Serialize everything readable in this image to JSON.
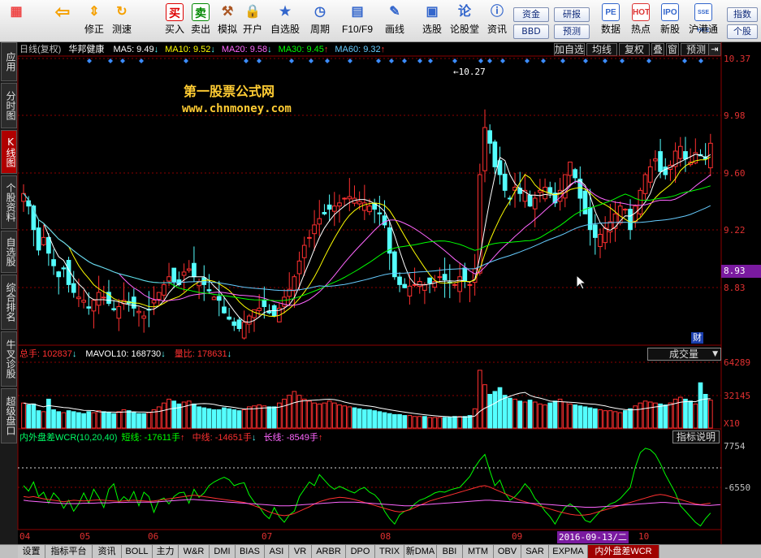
{
  "toolbar": {
    "items": [
      {
        "label": "",
        "icon": "grid-icon",
        "color": "#e44"
      },
      {
        "label": "",
        "icon": "back-arrow-icon",
        "color": "#f5a000"
      },
      {
        "label": "修正",
        "icon": "up-down-arrows-icon",
        "color": "#f5a000"
      },
      {
        "label": "测速",
        "icon": "refresh-icon",
        "color": "#f5a000"
      },
      {
        "label": "买入",
        "icon": "buy-icon",
        "text": "买",
        "color": "#d00"
      },
      {
        "label": "卖出",
        "icon": "sell-icon",
        "text": "卖",
        "color": "#080"
      },
      {
        "label": "模拟",
        "icon": "hammer-icon",
        "color": "#a52"
      },
      {
        "label": "开户",
        "icon": "lock-icon",
        "color": "#b80"
      },
      {
        "label": "自选股",
        "icon": "star-icon",
        "color": "#36c"
      },
      {
        "label": "周期",
        "icon": "clock-icon",
        "color": "#36c"
      },
      {
        "label": "F10/F9",
        "icon": "doc-icon",
        "color": "#36c"
      },
      {
        "label": "画线",
        "icon": "pen-icon",
        "color": "#36c"
      },
      {
        "label": "选股",
        "icon": "screen-icon",
        "color": "#36c"
      },
      {
        "label": "论股堂",
        "icon": "forum-icon",
        "color": "#36c"
      },
      {
        "label": "资讯",
        "icon": "info-icon",
        "color": "#36c"
      },
      {
        "label": "数据",
        "icon": "pe-icon",
        "text": "PE",
        "color": "#36c"
      },
      {
        "label": "热点",
        "icon": "hot-icon",
        "text": "HOT",
        "color": "#d33"
      },
      {
        "label": "新股",
        "icon": "ipo-icon",
        "text": "IPO",
        "color": "#36c"
      },
      {
        "label": "沪港通",
        "icon": "sse-hke-icon",
        "text": "SSE HKE",
        "color": "#36c"
      }
    ],
    "pills": {
      "capital": "资金",
      "bbd": "BBD",
      "research": "研报",
      "forecast": "预测",
      "index": "指数",
      "stock": "个股"
    }
  },
  "left_tabs": [
    "应用",
    "分时图",
    "K线图",
    "个股资料",
    "自选股",
    "综合排名",
    "牛叉诊股",
    "超级盘口"
  ],
  "active_left_tab": "K线图",
  "kline_header": {
    "period": "日线(复权)",
    "stock": "华邦健康",
    "ma": [
      {
        "label": "MA5:",
        "value": "9.49",
        "arrow": "↓",
        "color": "#ffffff"
      },
      {
        "label": "MA10:",
        "value": "9.52",
        "arrow": "↓",
        "color": "#ffff00"
      },
      {
        "label": "MA20:",
        "value": "9.58",
        "arrow": "↓",
        "color": "#ff66ff"
      },
      {
        "label": "MA30:",
        "value": "9.45",
        "arrow": "↑",
        "color": "#00ff00"
      },
      {
        "label": "MA60:",
        "value": "9.32",
        "arrow": "↑",
        "color": "#66ccff"
      }
    ],
    "buttons": [
      "加自选",
      "均线",
      "复权",
      "叠",
      "窗",
      "预测"
    ]
  },
  "watermark": {
    "title": "第一股票公式网",
    "url": "www.chnmoney.com"
  },
  "price_axis": {
    "labels": [
      "10.37",
      "9.98",
      "9.60",
      "9.22",
      "8.83"
    ],
    "current": "8.93",
    "high_marker": "10.27",
    "fin_badge": "财"
  },
  "volume_header": {
    "total_label": "总手:",
    "total": "102837",
    "mavol_label": "MAVOL10:",
    "mavol": "168730",
    "ratio_label": "量比:",
    "ratio": "178631",
    "dropdown": "成交量"
  },
  "volume_axis": {
    "labels": [
      "64289",
      "32145"
    ],
    "unit": "X10"
  },
  "indicator_header": {
    "name": "内外盘差WCR(10,20,40)",
    "short_label": "短线:",
    "short": "-17611手",
    "mid_label": "中线:",
    "mid": "-14651手",
    "long_label": "长线:",
    "long": "-8549手",
    "help": "指标说明"
  },
  "indicator_axis": {
    "labels": [
      "7754",
      "-6550"
    ]
  },
  "x_axis": {
    "months": [
      "04",
      "05",
      "06",
      "07",
      "08",
      "09",
      "10"
    ],
    "cursor_date": "2016-09-13/二"
  },
  "bottom_tabs": [
    "设置",
    "指标平台",
    "资讯",
    "BOLL",
    "主力",
    "W&R",
    "DMI",
    "BIAS",
    "ASI",
    "VR",
    "ARBR",
    "DPO",
    "TRIX",
    "新DMA",
    "BBI",
    "MTM",
    "OBV",
    "SAR",
    "EXPMA",
    "内外盘差WCR"
  ],
  "active_bottom_tab": "内外盘差WCR",
  "chart_data": {
    "type": "candlestick",
    "y_range": [
      8.64,
      10.45
    ],
    "ma_periods": [
      5,
      10,
      20,
      30,
      60
    ],
    "closes": [
      9.58,
      9.5,
      9.35,
      9.22,
      9.3,
      9.2,
      9.12,
      9.05,
      9.1,
      9.0,
      8.95,
      8.92,
      8.9,
      8.85,
      8.9,
      8.95,
      8.92,
      8.88,
      8.84,
      8.86,
      8.9,
      8.88,
      8.85,
      8.83,
      8.8,
      8.84,
      8.9,
      8.95,
      9.0,
      9.05,
      9.02,
      9.0,
      9.08,
      9.1,
      9.05,
      9.02,
      9.0,
      8.96,
      8.92,
      8.9,
      8.82,
      8.78,
      8.74,
      8.72,
      8.76,
      8.8,
      8.84,
      8.85,
      8.86,
      8.82,
      8.8,
      8.85,
      8.92,
      8.97,
      9.05,
      9.15,
      9.25,
      9.3,
      9.38,
      9.42,
      9.45,
      9.48,
      9.5,
      9.52,
      9.55,
      9.56,
      9.55,
      9.53,
      9.52,
      9.5,
      9.48,
      9.45,
      9.38,
      9.2,
      9.05,
      9.0,
      8.98,
      8.99,
      9.0,
      9.02,
      9.0,
      9.01,
      9.02,
      9.05,
      9.03,
      9.01,
      9.0,
      9.05,
      9.02,
      9.0,
      9.1,
      9.7,
      10.0,
      9.9,
      9.75,
      9.7,
      9.6,
      9.55,
      9.62,
      9.58,
      9.6,
      9.5,
      9.55,
      9.6,
      9.62,
      9.58,
      9.52,
      9.6,
      9.7,
      9.78,
      9.68,
      9.55,
      9.45,
      9.35,
      9.3,
      9.32,
      9.36,
      9.4,
      9.45,
      9.5,
      9.48,
      9.35,
      9.5,
      9.6,
      9.7,
      9.75,
      9.8,
      9.72,
      9.7,
      9.76,
      9.85,
      9.88,
      9.8,
      9.78,
      9.84,
      9.82,
      9.8,
      9.9
    ],
    "volume_range": [
      0,
      70000
    ],
    "volumes": [
      26000,
      24000,
      25000,
      18000,
      17000,
      30000,
      19000,
      17000,
      16000,
      18000,
      17000,
      16000,
      15000,
      17000,
      16000,
      18000,
      17000,
      16000,
      15000,
      17000,
      19000,
      18000,
      16000,
      15000,
      15000,
      16000,
      19000,
      22000,
      26000,
      30000,
      28000,
      25000,
      27000,
      28000,
      25000,
      22000,
      21000,
      20000,
      19000,
      19000,
      21000,
      20000,
      19000,
      18000,
      19000,
      22000,
      23000,
      24000,
      23000,
      22000,
      22000,
      26000,
      30000,
      34000,
      38000,
      34000,
      30000,
      28000,
      26000,
      25000,
      26000,
      28000,
      26000,
      24000,
      23000,
      22000,
      21000,
      20000,
      19000,
      19000,
      18000,
      17000,
      16000,
      15000,
      14000,
      14000,
      13000,
      13000,
      12000,
      12000,
      12000,
      11000,
      11000,
      11000,
      11000,
      11000,
      12000,
      12000,
      12000,
      13000,
      20000,
      60000,
      45000,
      35000,
      38000,
      42000,
      34000,
      31000,
      30000,
      28000,
      27000,
      29000,
      27000,
      25000,
      24000,
      26000,
      28000,
      30000,
      27000,
      25000,
      24000,
      23000,
      22000,
      21000,
      20000,
      19000,
      18000,
      18000,
      17000,
      16000,
      18000,
      20000,
      23000,
      26000,
      28000,
      27000,
      26000,
      25000,
      24000,
      26000,
      30000,
      32000,
      30000,
      28000,
      25000,
      47000,
      35000,
      29000
    ],
    "indicator_range": [
      -14000,
      9500
    ],
    "wcr_short": [
      -2000,
      -3500,
      -1000,
      -5000,
      -3800,
      -6800,
      -4000,
      -5500,
      -8200,
      -6000,
      -9000,
      -7000,
      -4000,
      -6800,
      -3000,
      -5200,
      -8000,
      -3000,
      -1500,
      -6600,
      -5000,
      -6200,
      -3600,
      -7500,
      -3800,
      -5000,
      -9300,
      -6000,
      -5400,
      -7000,
      -5000,
      -4000,
      -3800,
      -6800,
      -3000,
      -5200,
      -4000,
      -2000,
      -1000,
      -300,
      300,
      -400,
      -2000,
      -1500,
      -1200,
      -4500,
      -6500,
      -7800,
      -9800,
      -11000,
      -8000,
      -10500,
      -12000,
      -10000,
      -9000,
      -5000,
      -3000,
      -1000,
      -2000,
      1000,
      -500,
      -2000,
      -3000,
      -2200,
      -2800,
      -3500,
      -4000,
      -3000,
      -2500,
      -3800,
      -4500,
      -6000,
      -9000,
      -11000,
      -12500,
      -10000,
      -9000,
      -8500,
      -7000,
      -6000,
      -5500,
      -4800,
      -4000,
      -3600,
      -3800,
      -3200,
      -2800,
      -2500,
      -1000,
      500,
      3000,
      5000,
      6500,
      2000,
      -2000,
      -500,
      -4000,
      -6000,
      -5000,
      -3500,
      -1500,
      -3000,
      -5500,
      -7000,
      -9000,
      -10500,
      -12500,
      -10000,
      -8000,
      -7000,
      -8000,
      -9500,
      -11500,
      -12000,
      -10500,
      -9000,
      -8000,
      -7000,
      -6500,
      -5500,
      -4000,
      -2500,
      3000,
      7000,
      8200,
      7800,
      6500,
      4000,
      1000,
      -1500,
      -4000,
      -7500,
      -9000,
      -10500,
      -12000,
      -13000,
      -11000,
      -9500
    ],
    "wcr_mid": [
      -5000,
      -5200,
      -5000,
      -5300,
      -5600,
      -5800,
      -6000,
      -6200,
      -6400,
      -6200,
      -6000,
      -6100,
      -6200,
      -6100,
      -6000,
      -5900,
      -6000,
      -6100,
      -6200,
      -6300,
      -6200,
      -6100,
      -6000,
      -6100,
      -6200,
      -6300,
      -6200,
      -6000,
      -5800,
      -5600,
      -5400,
      -5200,
      -5000,
      -4800,
      -4600,
      -4800,
      -5000,
      -5200,
      -5400,
      -5600,
      -5800,
      -6000,
      -6200,
      -6400,
      -6600,
      -7000,
      -7500,
      -8000,
      -8600,
      -9200,
      -9600,
      -10000,
      -10200,
      -10000,
      -9600,
      -9000,
      -8400,
      -7800,
      -7000,
      -6400,
      -6000,
      -5600,
      -5400,
      -5200,
      -5300,
      -5500,
      -5800,
      -6200,
      -6600,
      -7000,
      -7400,
      -7800,
      -8200,
      -8600,
      -9000,
      -9200,
      -9000,
      -8600,
      -8000,
      -7400,
      -6800,
      -6200,
      -5800,
      -5400,
      -5000,
      -4600,
      -4200,
      -3800,
      -3400,
      -3000,
      -2600,
      -2200,
      -2000,
      -2400,
      -3000,
      -3600,
      -4200,
      -4800,
      -5400,
      -6000,
      -6400,
      -6800,
      -7200,
      -7600,
      -8000,
      -8400,
      -8800,
      -9200,
      -9500,
      -9800,
      -10000,
      -10100,
      -10000,
      -9800,
      -9400,
      -9000,
      -8600,
      -8200,
      -7800,
      -7400,
      -7000,
      -6600,
      -6200,
      -5800,
      -5400,
      -5000,
      -4600,
      -4400,
      -4600,
      -5000,
      -5400,
      -5800,
      -6200,
      -6600,
      -7000,
      -7200,
      -7000,
      -6800
    ],
    "wcr_long": [
      -6000,
      -6200,
      -6300,
      -6400,
      -6500,
      -6600,
      -6700,
      -6800,
      -6900,
      -6900,
      -6900,
      -6900,
      -6800,
      -6800,
      -6800,
      -6700,
      -6700,
      -6700,
      -6600,
      -6600,
      -6600,
      -6500,
      -6500,
      -6500,
      -6500,
      -6500,
      -6500,
      -6400,
      -6300,
      -6200,
      -6100,
      -6000,
      -5900,
      -5800,
      -5800,
      -5900,
      -6000,
      -6100,
      -6200,
      -6300,
      -6400,
      -6500,
      -6600,
      -6700,
      -6800,
      -6900,
      -7000,
      -7100,
      -7200,
      -7300,
      -7400,
      -7500,
      -7500,
      -7500,
      -7400,
      -7300,
      -7200,
      -7100,
      -7000,
      -6900,
      -6800,
      -6700,
      -6600,
      -6500,
      -6500,
      -6500,
      -6500,
      -6600,
      -6700,
      -6800,
      -6900,
      -7000,
      -7100,
      -7200,
      -7300,
      -7400,
      -7500,
      -7500,
      -7400,
      -7300,
      -7200,
      -7100,
      -7000,
      -6900,
      -6800,
      -6700,
      -6600,
      -6500,
      -6400,
      -6300,
      -6200,
      -6100,
      -6000,
      -6000,
      -6100,
      -6200,
      -6300,
      -6400,
      -6500,
      -6600,
      -6700,
      -6800,
      -6900,
      -7000,
      -7100,
      -7200,
      -7300,
      -7400,
      -7500,
      -7600,
      -7700,
      -7800,
      -7900,
      -7900,
      -7900,
      -7800,
      -7700,
      -7600,
      -7500,
      -7400,
      -7300,
      -7200,
      -7100,
      -7000,
      -6900,
      -6800,
      -6700,
      -6600,
      -6600,
      -6700,
      -6800,
      -6900,
      -7000,
      -7100,
      -7200,
      -7300,
      -7400,
      -7400,
      -7300,
      -7200
    ]
  },
  "colors": {
    "up": "#ff3030",
    "down": "#54ffff",
    "ma5": "#ffffff",
    "ma10": "#ffff00",
    "ma20": "#ff66ff",
    "ma30": "#00ff00",
    "ma60": "#66ccff",
    "grid": "#8b0000",
    "wcr_short": "#00ff00",
    "wcr_mid": "#ff3030",
    "wcr_long": "#ff66ff"
  }
}
